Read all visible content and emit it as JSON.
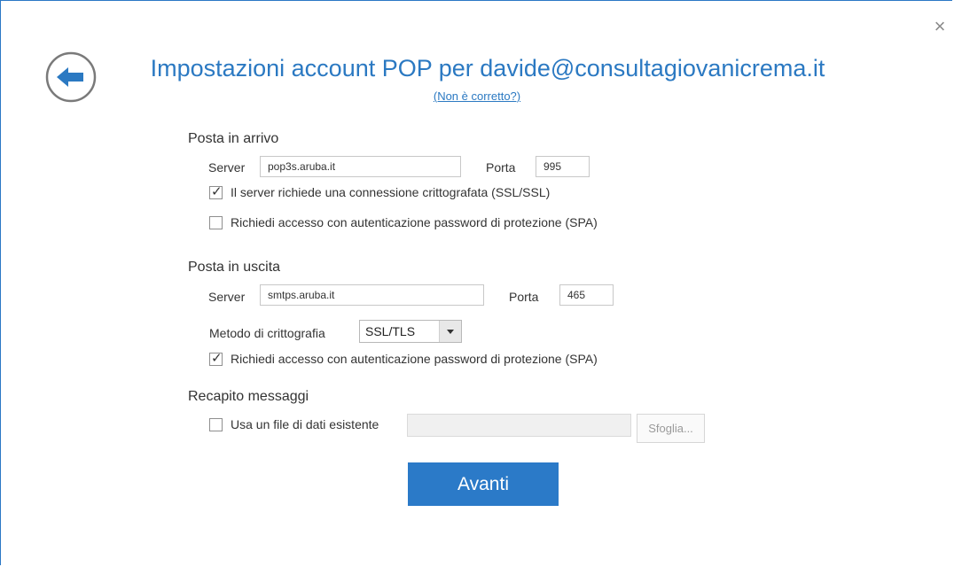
{
  "window": {
    "title": "Impostazioni account POP per davide@consultagiovanicrema.it",
    "subtitle_link": "(Non è corretto?)"
  },
  "incoming": {
    "heading": "Posta in arrivo",
    "server_label": "Server",
    "server_value": "pop3s.aruba.it",
    "port_label": "Porta",
    "port_value": "995",
    "ssl_label": "Il server richiede una connessione crittografata (SSL/SSL)",
    "ssl_checked": true,
    "spa_label": "Richiedi accesso con autenticazione password di protezione (SPA)",
    "spa_checked": false
  },
  "outgoing": {
    "heading": "Posta in uscita",
    "server_label": "Server",
    "server_value": "smtps.aruba.it",
    "port_label": "Porta",
    "port_value": "465",
    "encryption_label": "Metodo di crittografia",
    "encryption_value": "SSL/TLS",
    "spa_label": "Richiedi accesso con autenticazione password di protezione (SPA)",
    "spa_checked": true
  },
  "delivery": {
    "heading": "Recapito messaggi",
    "existing_file_label": "Usa un file di dati esistente",
    "existing_file_checked": false,
    "file_path_value": "",
    "browse_label": "Sfoglia..."
  },
  "actions": {
    "next_label": "Avanti"
  },
  "icons": {
    "close": "close-icon",
    "back": "back-arrow-icon"
  },
  "colors": {
    "accent": "#2b7ac8",
    "title": "#2b79c2"
  }
}
